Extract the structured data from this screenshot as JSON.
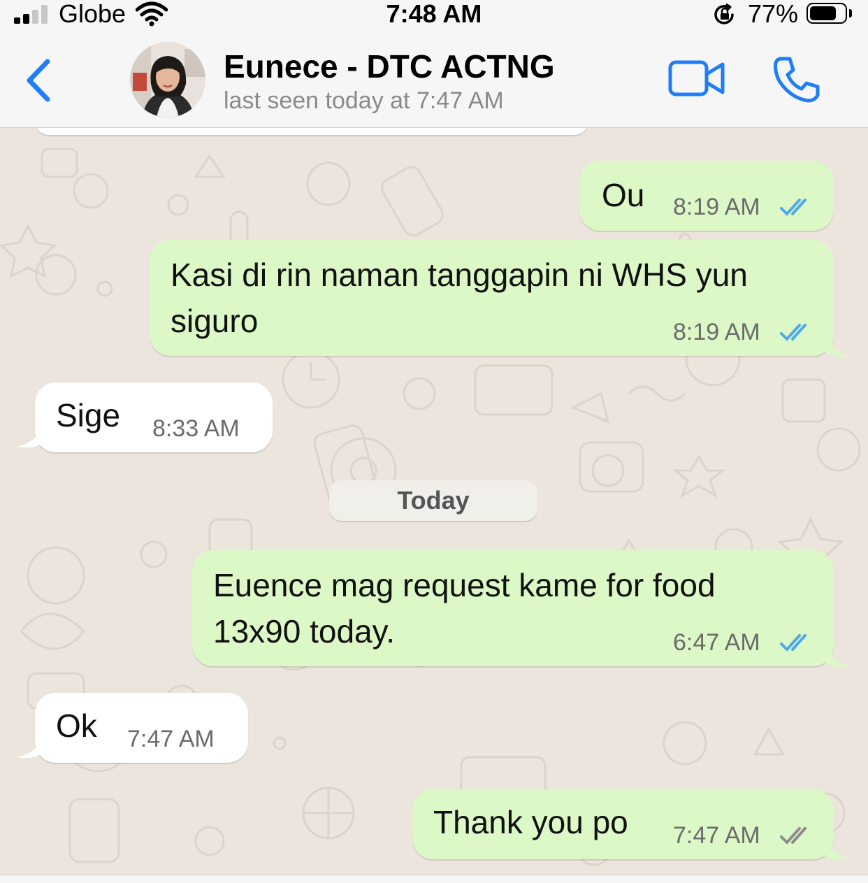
{
  "status_bar": {
    "carrier": "Globe",
    "time": "7:48 AM",
    "battery_percent": "77%",
    "battery_level": 0.77,
    "signal_bars": 2,
    "icons": [
      "signal-icon",
      "wifi-icon",
      "orientation-lock-icon",
      "battery-icon"
    ]
  },
  "header": {
    "contact_name": "Eunece - DTC ACTNG",
    "last_seen": "last seen today at 7:47 AM",
    "icons": [
      "back-chevron-icon",
      "video-call-icon",
      "phone-call-icon"
    ]
  },
  "messages": [
    {
      "direction": "outgoing",
      "lines": [
        "Ou"
      ],
      "time": "8:19 AM",
      "status": "read"
    },
    {
      "direction": "outgoing",
      "lines": [
        "Kasi di rin naman tanggapin ni WHS yun",
        "siguro"
      ],
      "time": "8:19 AM",
      "status": "read"
    },
    {
      "direction": "incoming",
      "lines": [
        "Sige"
      ],
      "time": "8:33 AM"
    },
    {
      "direction": "outgoing",
      "lines": [
        "Euence mag request kame for food",
        "13x90 today."
      ],
      "time": "6:47 AM",
      "status": "read"
    },
    {
      "direction": "incoming",
      "lines": [
        "Ok"
      ],
      "time": "7:47 AM"
    },
    {
      "direction": "outgoing",
      "lines": [
        "Thank you po"
      ],
      "time": "7:47 AM",
      "status": "delivered"
    }
  ],
  "date_separator": "Today",
  "colors": {
    "accent": "#1f7ef6",
    "outgoing_bubble": "#dcf8c6",
    "incoming_bubble": "#ffffff",
    "read_ticks": "#4fa9e8",
    "delivered_ticks": "#8c8c8c",
    "wallpaper": "#ece5dd"
  }
}
